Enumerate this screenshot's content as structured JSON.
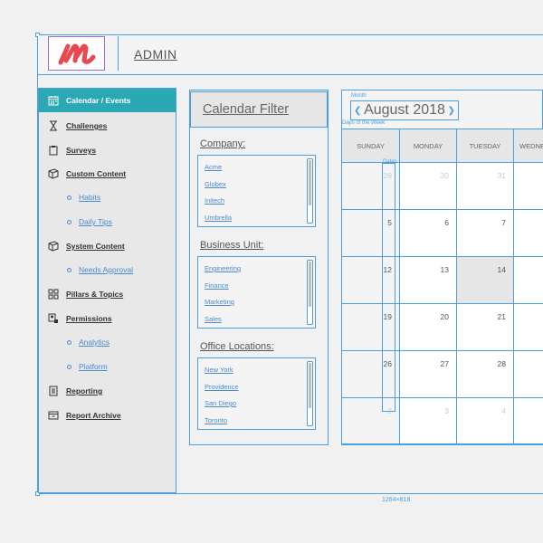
{
  "header": {
    "logo_icon": "brand-logo-icon",
    "admin_label": "ADMIN"
  },
  "sidebar": {
    "items": [
      {
        "label": "Calendar / Events",
        "icon": "calendar-icon",
        "active": true
      },
      {
        "label": "Challenges",
        "icon": "hourglass-icon"
      },
      {
        "label": "Surveys",
        "icon": "clipboard-icon"
      },
      {
        "label": "Custom Content",
        "icon": "cube-icon"
      },
      {
        "label": "Habits",
        "sub": true
      },
      {
        "label": "Daily Tips",
        "sub": true
      },
      {
        "label": "System Content",
        "icon": "cube-icon"
      },
      {
        "label": "Needs Approval",
        "sub": true
      },
      {
        "label": "Pillars & Topics",
        "icon": "grid-icon"
      },
      {
        "label": "Permissions",
        "icon": "user-lock-icon"
      },
      {
        "label": "Analytics",
        "sub": true
      },
      {
        "label": "Platform",
        "sub": true
      },
      {
        "label": "Reporting",
        "icon": "document-icon"
      },
      {
        "label": "Report Archive",
        "icon": "archive-icon"
      }
    ]
  },
  "filter": {
    "title": "Calendar Filter",
    "company": {
      "heading": "Company:",
      "items": [
        "Acme",
        "Globex",
        "Initech",
        "Umbrella"
      ]
    },
    "business_unit": {
      "heading": "Business Unit:",
      "items": [
        "Engineering",
        "Finance",
        "Marketing",
        "Sales"
      ]
    },
    "office_locations": {
      "heading": "Office Locations:",
      "items": [
        "New York",
        "Providence",
        "San Diego",
        "Toronto"
      ]
    }
  },
  "calendar": {
    "month_label": "Month",
    "title": "August 2018",
    "prev_icon": "chevron-left-icon",
    "next_icon": "chevron-right-icon",
    "days_label": "Days of the Week",
    "dates_label": "Dates",
    "days": [
      "SUNDAY",
      "MONDAY",
      "TUESDAY",
      "WEDNESDAY"
    ],
    "weeks": [
      [
        "29",
        "30",
        "31",
        ""
      ],
      [
        "5",
        "6",
        "7",
        ""
      ],
      [
        "12",
        "13",
        "14",
        ""
      ],
      [
        "19",
        "20",
        "21",
        ""
      ],
      [
        "26",
        "27",
        "28",
        ""
      ],
      [
        "2",
        "3",
        "4",
        ""
      ]
    ],
    "today": "14"
  },
  "canvas": {
    "dimension_label": "1264×818"
  }
}
